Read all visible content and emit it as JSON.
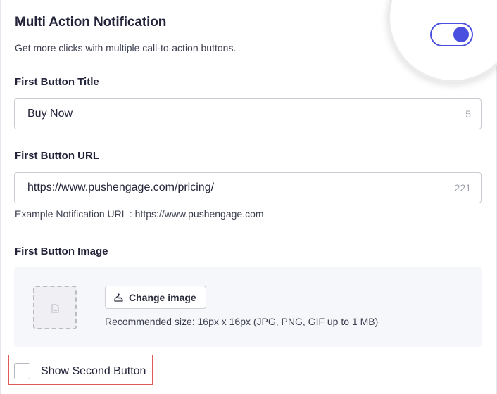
{
  "header": {
    "title": "Multi Action Notification",
    "subtitle": "Get more clicks with multiple call-to-action buttons.",
    "toggle_on": true,
    "accent_color": "#4a4fe0"
  },
  "first_button_title": {
    "label": "First Button Title",
    "value": "Buy Now",
    "counter": "5"
  },
  "first_button_url": {
    "label": "First Button URL",
    "value": "https://www.pushengage.com/pricing/",
    "counter": "221",
    "hint": "Example Notification URL : https://www.pushengage.com"
  },
  "first_button_image": {
    "label": "First Button Image",
    "placeholder_icon": "image-file-icon",
    "change_label": "Change image",
    "change_icon": "image-upload-icon",
    "recommendation": "Recommended size: 16px x 16px (JPG, PNG, GIF up to 1 MB)"
  },
  "second_button": {
    "checkbox_label": "Show Second Button",
    "checked": false
  }
}
